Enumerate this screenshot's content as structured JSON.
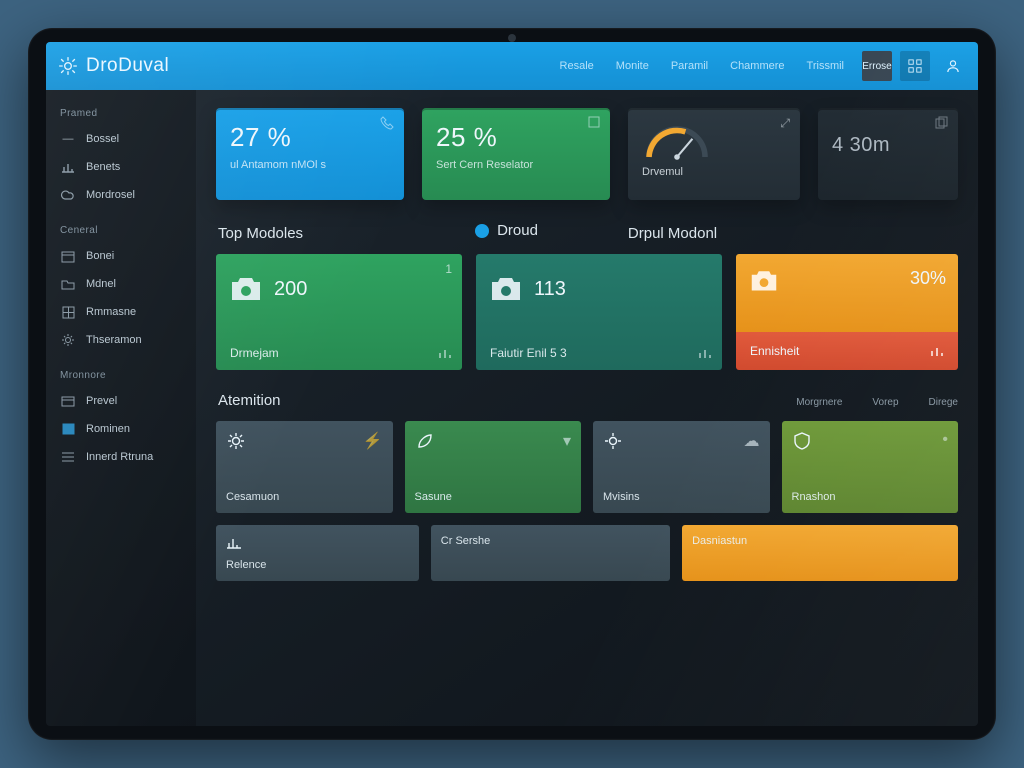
{
  "brand": "DroDuval",
  "nav": [
    "Resale",
    "Monite",
    "Paramil",
    "Chammere",
    "Trissmil",
    "Errose"
  ],
  "topicons": [
    "grid",
    "user"
  ],
  "sidebar": {
    "group1": "Pramed",
    "items1": [
      "Bossel",
      "Benets",
      "Mordrosel"
    ],
    "group2": "Ceneral",
    "items2": [
      "Bonei",
      "Mdnel",
      "Rmmasne",
      "Thseramon"
    ],
    "group3": "Mronnore",
    "items3": [
      "Prevel",
      "Rominen",
      "Innerd Rtruna"
    ]
  },
  "stats": [
    {
      "big": "27 %",
      "sub": "ul Antamom nMOl s",
      "corner": "phone-icon"
    },
    {
      "big": "25 %",
      "sub": "Sert Cern Reselator",
      "corner": "square-icon"
    },
    {
      "big": "",
      "sub": "Drvemul",
      "gauge": true,
      "corner": "gauge-icon"
    },
    {
      "big": "4 30m",
      "sub": "",
      "corner": "copy-icon"
    }
  ],
  "sections": {
    "top_modules": "Top Modoles",
    "droud": "Droud",
    "drpul": "Drpul Modonl",
    "attention": "Atemition",
    "meta_left": "Morgrnere",
    "meta_mid": "Vorep",
    "meta_right": "Direge"
  },
  "mods": [
    {
      "val": "200",
      "ttl": "Drmejam",
      "mini": "1"
    },
    {
      "val": "113",
      "ttl": "Faiutir Enil 5 3",
      "mini": ""
    },
    {
      "val": "30%",
      "ttl": "Ennisheit",
      "mini": ""
    }
  ],
  "tiles": [
    {
      "lbl": "Cesamuon"
    },
    {
      "lbl": "Sasune"
    },
    {
      "lbl": "Mvisins"
    },
    {
      "lbl": "Rnashon"
    }
  ],
  "bottom": [
    {
      "lbl": "Relence"
    },
    {
      "lbl": "Cr Sershe"
    },
    {
      "lbl": "Dasniastun"
    }
  ]
}
